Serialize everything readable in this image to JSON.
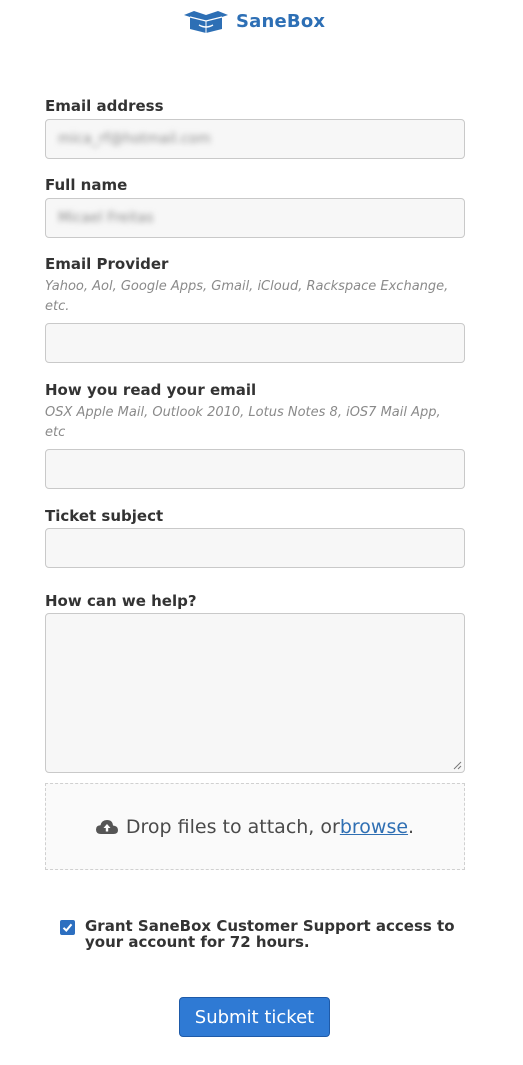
{
  "brand": {
    "name": "SaneBox",
    "color": "#2d6fb5",
    "icon": "sanebox-box-icon"
  },
  "fields": {
    "email": {
      "label": "Email address",
      "value": "mica_rf@hotmail.com"
    },
    "full_name": {
      "label": "Full name",
      "value": "Micael Freitas"
    },
    "provider": {
      "label": "Email Provider",
      "hint": "Yahoo, Aol, Google Apps, Gmail, iCloud, Rackspace Exchange, etc.",
      "value": ""
    },
    "client": {
      "label": "How you read your email",
      "hint": "OSX Apple Mail, Outlook 2010, Lotus Notes 8, iOS7 Mail App, etc",
      "value": ""
    },
    "subject": {
      "label": "Ticket subject",
      "value": ""
    },
    "help": {
      "label": "How can we help?",
      "value": ""
    }
  },
  "dropzone": {
    "text": "Drop files to attach, or ",
    "link": "browse",
    "suffix": ".",
    "icon": "cloud-upload-icon"
  },
  "consent": {
    "checked": true,
    "text": "Grant SaneBox Customer Support access to your account for 72 hours."
  },
  "submit": {
    "label": "Submit ticket",
    "color": "#2f7ad4"
  }
}
